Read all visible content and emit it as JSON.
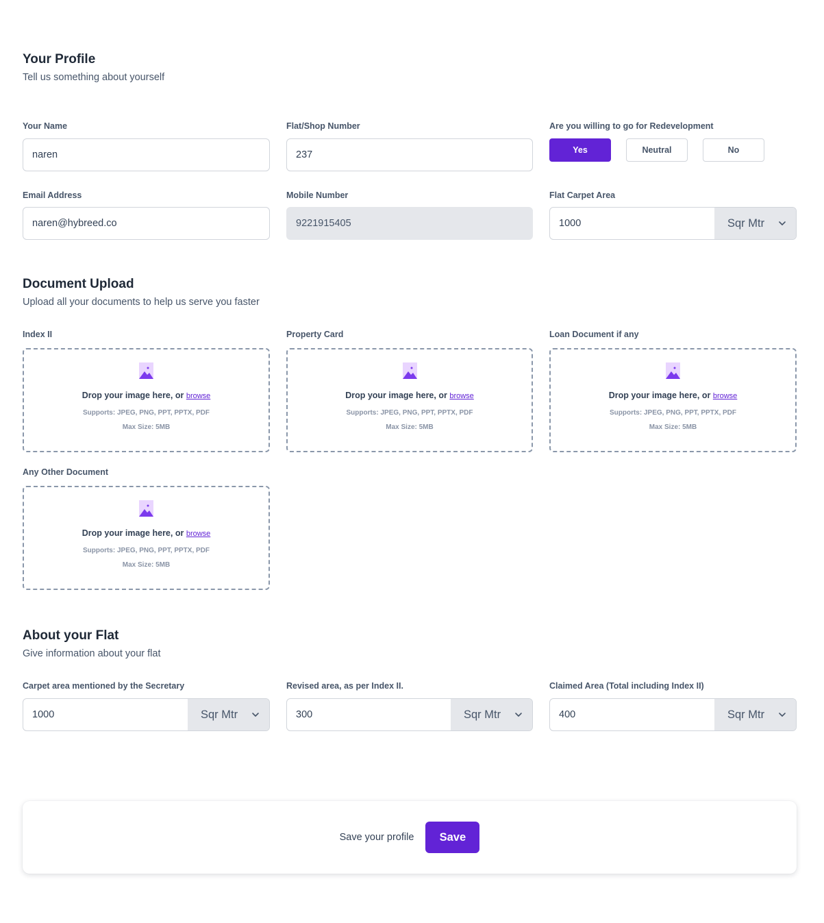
{
  "profile": {
    "title": "Your Profile",
    "subtitle": "Tell us something about yourself",
    "name_label": "Your Name",
    "name_value": "naren",
    "flat_label": "Flat/Shop Number",
    "flat_value": "237",
    "redev_label": "Are you willing to go for Redevelopment",
    "redev_options": [
      "Yes",
      "Neutral",
      "No"
    ],
    "redev_selected": "Yes",
    "email_label": "Email Address",
    "email_value": "naren@hybreed.co",
    "mobile_label": "Mobile Number",
    "mobile_value": "9221915405",
    "carpet_label": "Flat Carpet Area",
    "carpet_value": "1000",
    "carpet_unit": "Sqr Mtr"
  },
  "documents": {
    "title": "Document Upload",
    "subtitle": "Upload all your documents to help us serve you faster",
    "drop_text": "Drop your image here, or",
    "browse_text": "browse",
    "supports_text": "Supports: JPEG, PNG, PPT, PPTX, PDF",
    "max_text": "Max Size: 5MB",
    "items": [
      {
        "label": "Index II"
      },
      {
        "label": "Property Card"
      },
      {
        "label": "Loan Document if any"
      },
      {
        "label": "Any Other Document"
      }
    ]
  },
  "flat": {
    "title": "About your Flat",
    "subtitle": "Give information about your flat",
    "fields": [
      {
        "label": "Carpet area mentioned by the Secretary",
        "value": "1000",
        "unit": "Sqr Mtr"
      },
      {
        "label": "Revised area, as per Index II.",
        "value": "300",
        "unit": "Sqr Mtr"
      },
      {
        "label": "Claimed Area (Total including Index II)",
        "value": "400",
        "unit": "Sqr Mtr"
      }
    ]
  },
  "save": {
    "prompt": "Save your profile",
    "button": "Save"
  },
  "colors": {
    "accent": "#6223d6",
    "icon_light": "#e9d5ff",
    "icon_dark": "#7c3aed"
  }
}
